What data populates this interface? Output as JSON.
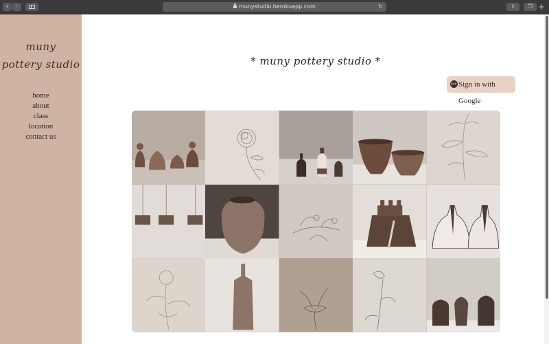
{
  "browser": {
    "url": "munystudio.herokuapp.com",
    "back_icon": "chevron-left-icon",
    "forward_icon": "chevron-right-icon",
    "sidebar_icon": "sidebar-icon",
    "reload_icon": "reload-icon",
    "share_icon": "share-icon",
    "tabs_icon": "tabs-icon",
    "new_tab_label": "+"
  },
  "sidebar": {
    "logo_line1": "muny",
    "logo_line2": "pottery studio",
    "nav": [
      {
        "label": "home"
      },
      {
        "label": "about"
      },
      {
        "label": "class"
      },
      {
        "label": "location"
      },
      {
        "label": "contact us"
      }
    ],
    "background": "#cfb3a3"
  },
  "main": {
    "title": "* muny pottery studio *",
    "signin_label": "Sign in with Google",
    "signin_icon": "google-plus-icon",
    "gallery": [
      {
        "subject": "pottery"
      },
      {
        "subject": "drawing"
      },
      {
        "subject": "pottery"
      },
      {
        "subject": "pottery"
      },
      {
        "subject": "drawing"
      },
      {
        "subject": "pottery"
      },
      {
        "subject": "pottery"
      },
      {
        "subject": "drawing"
      },
      {
        "subject": "pottery"
      },
      {
        "subject": "pottery"
      },
      {
        "subject": "drawing"
      },
      {
        "subject": "pottery"
      },
      {
        "subject": "drawing"
      },
      {
        "subject": "drawing"
      },
      {
        "subject": "pottery"
      }
    ]
  }
}
